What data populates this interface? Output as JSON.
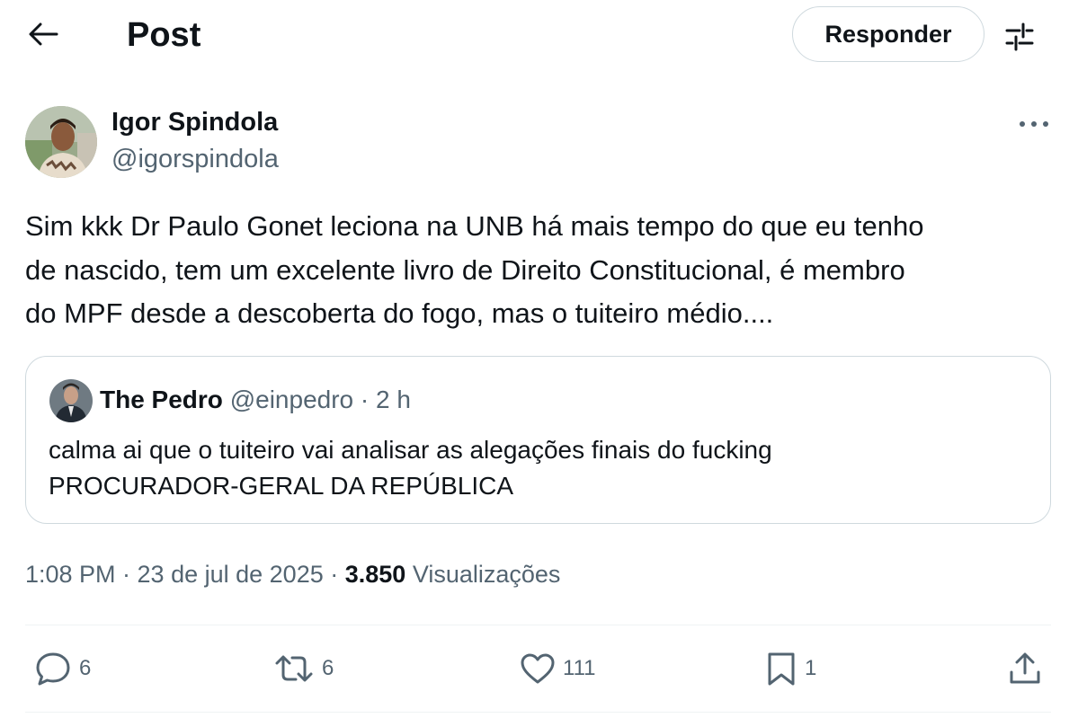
{
  "header": {
    "title": "Post",
    "reply_label": "Responder",
    "back_icon": "arrow-left-icon",
    "filter_icon": "sliders-icon"
  },
  "author": {
    "name": "Igor Spindola",
    "handle": "@igorspindola"
  },
  "post": {
    "text": "Sim kkk Dr Paulo Gonet leciona na UNB há mais tempo do que eu tenho\nde nascido, tem um excelente livro de Direito Constitucional, é membro\ndo MPF desde a descoberta do fogo, mas o tuiteiro médio...."
  },
  "quote": {
    "name": "The Pedro",
    "meta": "@einpedro · 2 h",
    "text": "calma ai que o tuiteiro vai analisar as alegações finais do fucking\nPROCURADOR-GERAL DA REPÚBLICA"
  },
  "meta": {
    "time_date": "1:08 PM · 23 de jul de 2025 · ",
    "views_count": "3.850",
    "views_label": "Visualizações"
  },
  "actions": {
    "replies": "6",
    "reposts": "6",
    "likes": "111",
    "bookmarks": "1"
  },
  "colors": {
    "text_primary": "#0f1419",
    "text_secondary": "#536471",
    "border": "#cfd9de"
  }
}
